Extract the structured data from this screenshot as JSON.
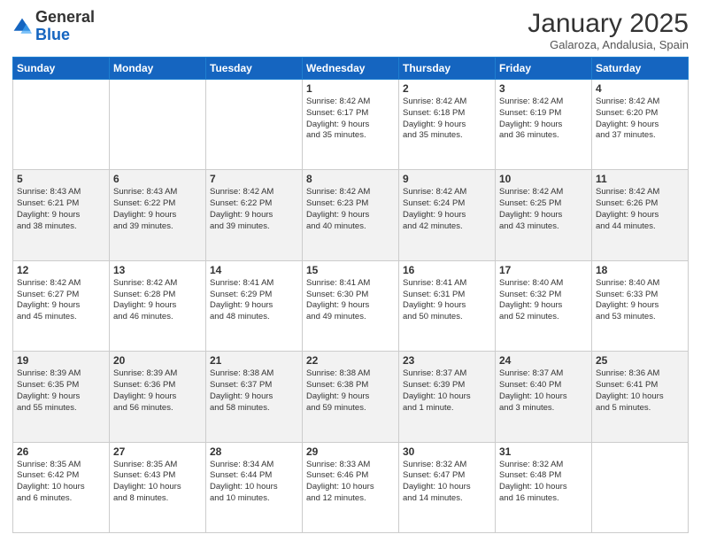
{
  "header": {
    "logo_general": "General",
    "logo_blue": "Blue",
    "month_title": "January 2025",
    "location": "Galaroza, Andalusia, Spain"
  },
  "weekdays": [
    "Sunday",
    "Monday",
    "Tuesday",
    "Wednesday",
    "Thursday",
    "Friday",
    "Saturday"
  ],
  "weeks": [
    [
      {
        "day": "",
        "info": ""
      },
      {
        "day": "",
        "info": ""
      },
      {
        "day": "",
        "info": ""
      },
      {
        "day": "1",
        "info": "Sunrise: 8:42 AM\nSunset: 6:17 PM\nDaylight: 9 hours\nand 35 minutes."
      },
      {
        "day": "2",
        "info": "Sunrise: 8:42 AM\nSunset: 6:18 PM\nDaylight: 9 hours\nand 35 minutes."
      },
      {
        "day": "3",
        "info": "Sunrise: 8:42 AM\nSunset: 6:19 PM\nDaylight: 9 hours\nand 36 minutes."
      },
      {
        "day": "4",
        "info": "Sunrise: 8:42 AM\nSunset: 6:20 PM\nDaylight: 9 hours\nand 37 minutes."
      }
    ],
    [
      {
        "day": "5",
        "info": "Sunrise: 8:43 AM\nSunset: 6:21 PM\nDaylight: 9 hours\nand 38 minutes."
      },
      {
        "day": "6",
        "info": "Sunrise: 8:43 AM\nSunset: 6:22 PM\nDaylight: 9 hours\nand 39 minutes."
      },
      {
        "day": "7",
        "info": "Sunrise: 8:42 AM\nSunset: 6:22 PM\nDaylight: 9 hours\nand 39 minutes."
      },
      {
        "day": "8",
        "info": "Sunrise: 8:42 AM\nSunset: 6:23 PM\nDaylight: 9 hours\nand 40 minutes."
      },
      {
        "day": "9",
        "info": "Sunrise: 8:42 AM\nSunset: 6:24 PM\nDaylight: 9 hours\nand 42 minutes."
      },
      {
        "day": "10",
        "info": "Sunrise: 8:42 AM\nSunset: 6:25 PM\nDaylight: 9 hours\nand 43 minutes."
      },
      {
        "day": "11",
        "info": "Sunrise: 8:42 AM\nSunset: 6:26 PM\nDaylight: 9 hours\nand 44 minutes."
      }
    ],
    [
      {
        "day": "12",
        "info": "Sunrise: 8:42 AM\nSunset: 6:27 PM\nDaylight: 9 hours\nand 45 minutes."
      },
      {
        "day": "13",
        "info": "Sunrise: 8:42 AM\nSunset: 6:28 PM\nDaylight: 9 hours\nand 46 minutes."
      },
      {
        "day": "14",
        "info": "Sunrise: 8:41 AM\nSunset: 6:29 PM\nDaylight: 9 hours\nand 48 minutes."
      },
      {
        "day": "15",
        "info": "Sunrise: 8:41 AM\nSunset: 6:30 PM\nDaylight: 9 hours\nand 49 minutes."
      },
      {
        "day": "16",
        "info": "Sunrise: 8:41 AM\nSunset: 6:31 PM\nDaylight: 9 hours\nand 50 minutes."
      },
      {
        "day": "17",
        "info": "Sunrise: 8:40 AM\nSunset: 6:32 PM\nDaylight: 9 hours\nand 52 minutes."
      },
      {
        "day": "18",
        "info": "Sunrise: 8:40 AM\nSunset: 6:33 PM\nDaylight: 9 hours\nand 53 minutes."
      }
    ],
    [
      {
        "day": "19",
        "info": "Sunrise: 8:39 AM\nSunset: 6:35 PM\nDaylight: 9 hours\nand 55 minutes."
      },
      {
        "day": "20",
        "info": "Sunrise: 8:39 AM\nSunset: 6:36 PM\nDaylight: 9 hours\nand 56 minutes."
      },
      {
        "day": "21",
        "info": "Sunrise: 8:38 AM\nSunset: 6:37 PM\nDaylight: 9 hours\nand 58 minutes."
      },
      {
        "day": "22",
        "info": "Sunrise: 8:38 AM\nSunset: 6:38 PM\nDaylight: 9 hours\nand 59 minutes."
      },
      {
        "day": "23",
        "info": "Sunrise: 8:37 AM\nSunset: 6:39 PM\nDaylight: 10 hours\nand 1 minute."
      },
      {
        "day": "24",
        "info": "Sunrise: 8:37 AM\nSunset: 6:40 PM\nDaylight: 10 hours\nand 3 minutes."
      },
      {
        "day": "25",
        "info": "Sunrise: 8:36 AM\nSunset: 6:41 PM\nDaylight: 10 hours\nand 5 minutes."
      }
    ],
    [
      {
        "day": "26",
        "info": "Sunrise: 8:35 AM\nSunset: 6:42 PM\nDaylight: 10 hours\nand 6 minutes."
      },
      {
        "day": "27",
        "info": "Sunrise: 8:35 AM\nSunset: 6:43 PM\nDaylight: 10 hours\nand 8 minutes."
      },
      {
        "day": "28",
        "info": "Sunrise: 8:34 AM\nSunset: 6:44 PM\nDaylight: 10 hours\nand 10 minutes."
      },
      {
        "day": "29",
        "info": "Sunrise: 8:33 AM\nSunset: 6:46 PM\nDaylight: 10 hours\nand 12 minutes."
      },
      {
        "day": "30",
        "info": "Sunrise: 8:32 AM\nSunset: 6:47 PM\nDaylight: 10 hours\nand 14 minutes."
      },
      {
        "day": "31",
        "info": "Sunrise: 8:32 AM\nSunset: 6:48 PM\nDaylight: 10 hours\nand 16 minutes."
      },
      {
        "day": "",
        "info": ""
      }
    ]
  ]
}
